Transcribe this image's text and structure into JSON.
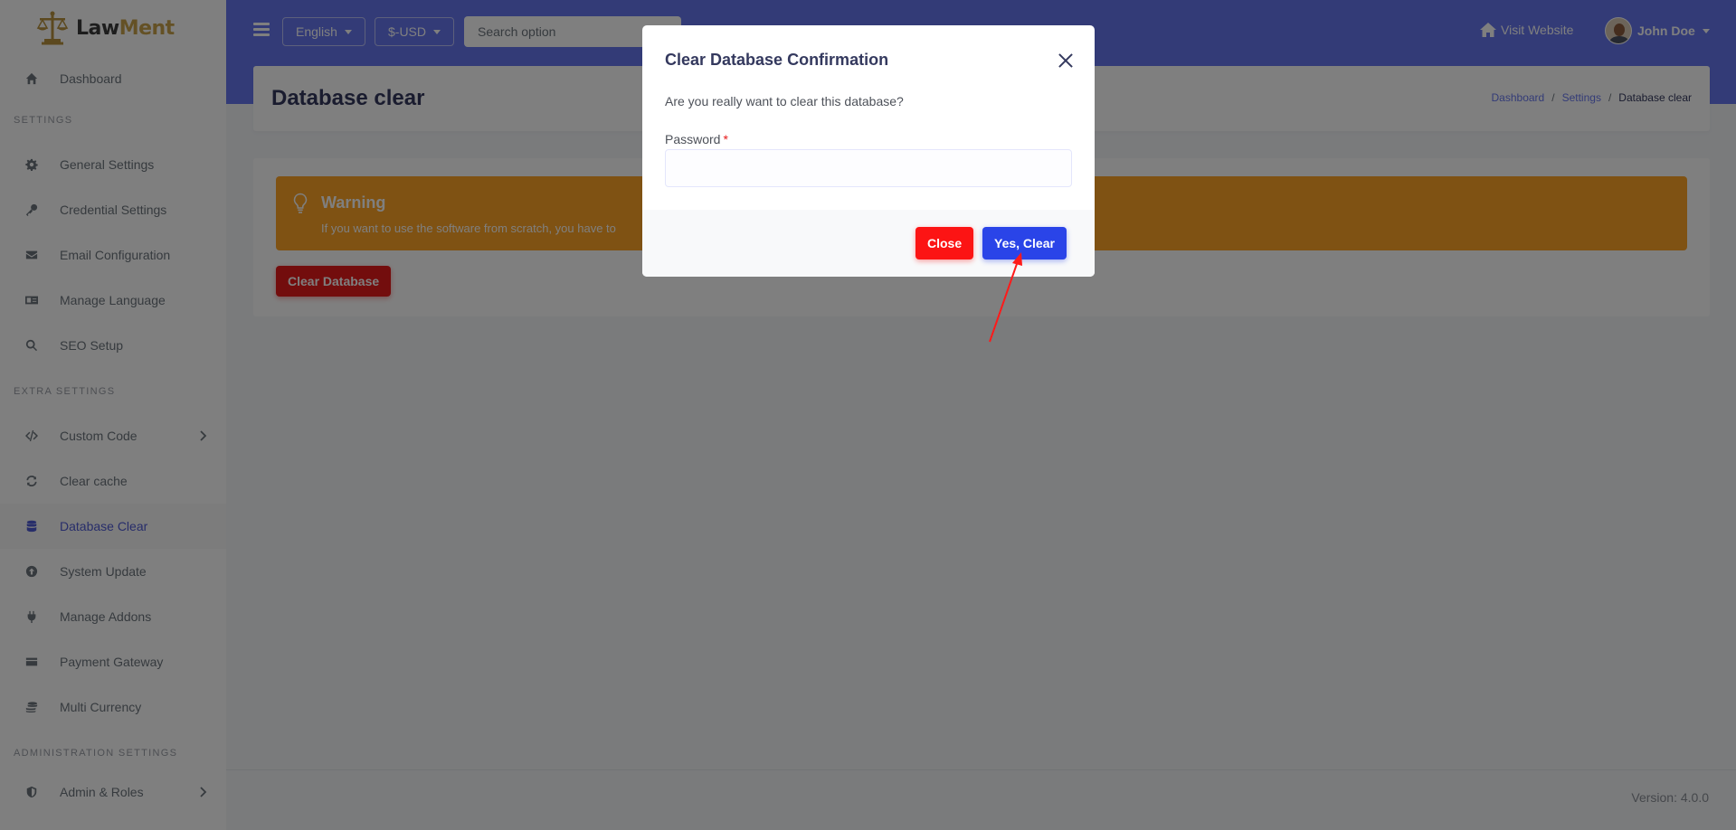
{
  "brand": {
    "name_part1": "Law",
    "name_part2": "Ment"
  },
  "sidebar": {
    "items": [
      {
        "label": "Dashboard",
        "icon": "home-icon"
      },
      {
        "header": "SETTINGS"
      },
      {
        "label": "General Settings",
        "icon": "gear-icon"
      },
      {
        "label": "Credential Settings",
        "icon": "key-icon"
      },
      {
        "label": "Email Configuration",
        "icon": "envelope-icon"
      },
      {
        "label": "Manage Language",
        "icon": "language-icon"
      },
      {
        "label": "SEO Setup",
        "icon": "search-icon"
      },
      {
        "header": "EXTRA SETTINGS"
      },
      {
        "label": "Custom Code",
        "icon": "code-icon"
      },
      {
        "label": "Clear cache",
        "icon": "sync-icon"
      },
      {
        "label": "Database Clear",
        "icon": "database-icon",
        "active": true
      },
      {
        "label": "System Update",
        "icon": "upload-icon"
      },
      {
        "label": "Manage Addons",
        "icon": "plug-icon"
      },
      {
        "label": "Payment Gateway",
        "icon": "credit-card-icon"
      },
      {
        "label": "Multi Currency",
        "icon": "coins-icon"
      },
      {
        "header": "ADMINISTRATION SETTINGS"
      },
      {
        "label": "Admin & Roles",
        "icon": "shield-icon"
      }
    ]
  },
  "topbar": {
    "language": "English",
    "currency": "$-USD",
    "search_placeholder": "Search option",
    "visit_website": "Visit Website",
    "user_name": "John Doe"
  },
  "page": {
    "title": "Database clear",
    "breadcrumb": [
      "Dashboard",
      "Settings",
      "Database clear"
    ]
  },
  "alert": {
    "title": "Warning",
    "text": "If you want to use the software from scratch, you have to"
  },
  "clear_database_button": "Clear Database",
  "footer": {
    "version": "Version: 4.0.0"
  },
  "modal": {
    "title": "Clear Database Confirmation",
    "question": "Are you really want to clear this database?",
    "password_label": "Password",
    "required_mark": "*",
    "close_button": "Close",
    "confirm_button": "Yes, Clear"
  },
  "colors": {
    "topbar": "#6777ef",
    "warning": "#ffa426",
    "danger": "#fc1414",
    "primary": "#2a44e8",
    "active_nav": "#4f5bd5"
  }
}
